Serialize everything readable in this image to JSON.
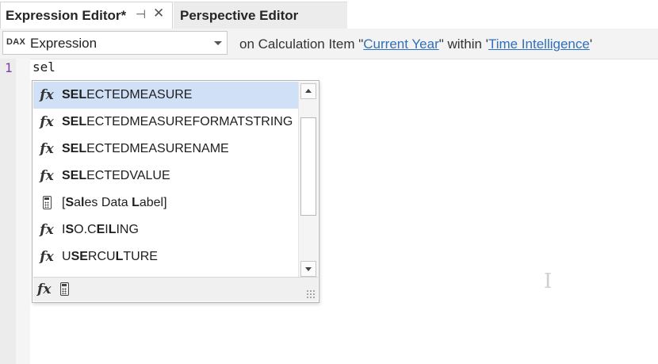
{
  "tabs": [
    {
      "label": "Expression Editor*",
      "active": true
    },
    {
      "label": "Perspective Editor",
      "active": false
    }
  ],
  "tab_icons": {
    "pin": "pin-icon",
    "close": "close-icon"
  },
  "toolbar": {
    "language_badge": "DAX",
    "combo_value": "Expression",
    "context_prefix": "on Calculation Item \"",
    "calc_item": "Current Year",
    "context_mid": "\" within '",
    "calc_group": "Time Intelligence",
    "context_suffix": "'"
  },
  "editor": {
    "line_number": "1",
    "code": "sel"
  },
  "autocomplete": {
    "items": [
      {
        "icon": "function-icon",
        "bold": "SEL",
        "rest": "ECTEDMEASURE",
        "selected": true
      },
      {
        "icon": "function-icon",
        "bold": "SEL",
        "rest": "ECTEDMEASUREFORMATSTRING",
        "selected": false
      },
      {
        "icon": "function-icon",
        "bold": "SEL",
        "rest": "ECTEDMEASURENAME",
        "selected": false
      },
      {
        "icon": "function-icon",
        "bold": "SEL",
        "rest": "ECTEDVALUE",
        "selected": false
      },
      {
        "icon": "measure-icon",
        "segments": [
          "[",
          "S",
          "a",
          "l",
          "es Data ",
          "L",
          "abel]"
        ],
        "bold_mask": [
          false,
          true,
          false,
          true,
          false,
          true,
          false
        ],
        "selected": false
      },
      {
        "icon": "function-icon",
        "segments": [
          "I",
          "S",
          "O.C",
          "E",
          "I",
          "L",
          "ING"
        ],
        "bold_mask": [
          false,
          true,
          false,
          true,
          false,
          true,
          false
        ],
        "selected": false
      },
      {
        "icon": "function-icon",
        "segments": [
          "U",
          "SE",
          "RCU",
          "L",
          "TURE"
        ],
        "bold_mask": [
          false,
          true,
          false,
          true,
          false
        ],
        "selected": false
      }
    ],
    "footer_filters": [
      "function-filter-icon",
      "measure-filter-icon"
    ]
  },
  "colors": {
    "selected_row": "#cfe0f7",
    "link": "#2f6fbd",
    "line_number": "#7a3fa6"
  }
}
